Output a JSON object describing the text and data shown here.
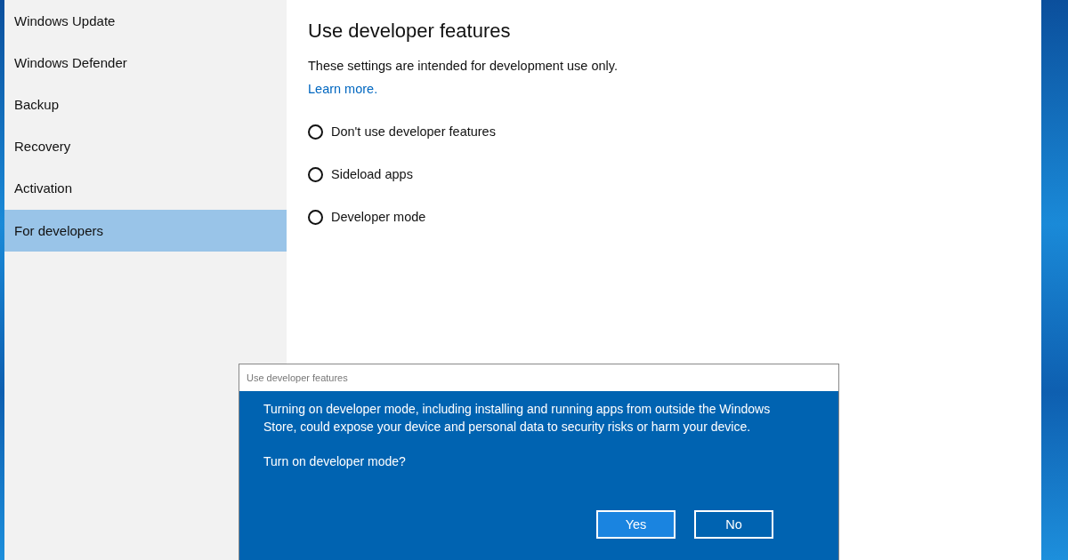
{
  "sidebar": {
    "items": [
      {
        "label": "Windows Update",
        "selected": false
      },
      {
        "label": "Windows Defender",
        "selected": false
      },
      {
        "label": "Backup",
        "selected": false
      },
      {
        "label": "Recovery",
        "selected": false
      },
      {
        "label": "Activation",
        "selected": false
      },
      {
        "label": "For developers",
        "selected": true
      }
    ]
  },
  "content": {
    "title": "Use developer features",
    "description": "These settings are intended for development use only.",
    "link": "Learn more.",
    "options": [
      {
        "label": "Don't use developer features",
        "selected": false
      },
      {
        "label": "Sideload apps",
        "selected": false
      },
      {
        "label": "Developer mode",
        "selected": false
      }
    ]
  },
  "dialog": {
    "title": "Use developer features",
    "message": "Turning on developer mode, including installing and running apps from outside the Windows Store, could expose your device and personal data to security risks or harm your device.",
    "question": "Turn on developer mode?",
    "buttons": [
      {
        "label": "Yes",
        "focused": true
      },
      {
        "label": "No",
        "focused": false
      }
    ]
  }
}
